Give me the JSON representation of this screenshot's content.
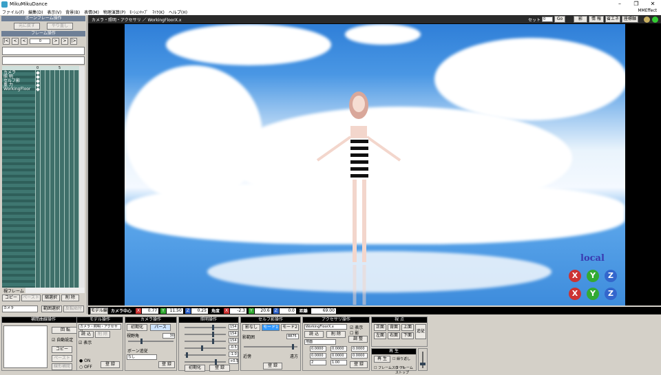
{
  "window": {
    "title": "MikuMikuDance",
    "mme_label": "MMEffect"
  },
  "menu": [
    "ファイル(F)",
    "編集(D)",
    "表示(V)",
    "背景(B)",
    "表情(M)",
    "物理演算(P)",
    "ﾓｰｼｮﾝｷｬﾌﾟ",
    "ﾏｲｸ(K)",
    "ヘルプ(H)"
  ],
  "left": {
    "bone_frame_header": "ボーンフレーム操作",
    "undo": "元に戻す",
    "redo": "やり直し",
    "frame_op_header": "フレーム操作",
    "frame_value": "0",
    "frame_nav": [
      "|<",
      "<",
      "<",
      ">",
      ">",
      "|>"
    ],
    "tl_ticks": [
      "0",
      "5"
    ],
    "tl_rows": [
      "カメラ",
      "照 明",
      "セルフ影",
      "重 力",
      "WorkingFloor"
    ],
    "view_frame_label": "視フレーム",
    "edit_buttons": [
      "コピー",
      "ペースト",
      "縮選択",
      "削 除"
    ],
    "camera_select": "カメラ",
    "range_select": "範囲選択",
    "reverse_paste": "反転貼付"
  },
  "viewport": {
    "toolbar_title": "カメラ・照明・アクセサリ ／ WorkingFloorX.x",
    "set_label": "セット",
    "set_value": "0",
    "go": "Go",
    "right_buttons": [
      "影",
      "情 報",
      "省エネ",
      "座標軸"
    ],
    "local_label": "local"
  },
  "camera_row": {
    "mode_label": "モデル編",
    "center_label": "カメラ中心",
    "x": "0.77",
    "y": "11.50",
    "z": "0.25",
    "angle_label": "角度",
    "ax": "-2.3",
    "ay": "20.6",
    "az": "0.0",
    "dist_label": "距離",
    "dist": "69.00"
  },
  "bottom": {
    "interp": {
      "header": "補間曲線操作",
      "rotate": "回 転",
      "auto": "自動設定",
      "copy": "コピー",
      "paste": "ペースト",
      "linear": "線形補間"
    },
    "model": {
      "header": "モデル操作",
      "select": "カメラ・照明・アクセサリ",
      "load": "読 込",
      "delete": "削 除",
      "display": "表示",
      "on": "ON",
      "off": "OFF",
      "register": "登 録"
    },
    "camera": {
      "header": "カメラ操作",
      "init": "初期化",
      "perspective": "パース",
      "fov_label": "視野角",
      "fov": "30",
      "bone_follow": "ボーン追従",
      "bone_none": "なし",
      "register": "登 録"
    },
    "light": {
      "header": "照明操作",
      "r": "154",
      "g": "154",
      "b": "154",
      "x": "-0.5",
      "y": "-1.0",
      "z": "+0.5",
      "init": "初期化",
      "register": "登 録"
    },
    "self_shadow": {
      "header": "セルフ影操作",
      "none": "影なし",
      "mode1": "モード1",
      "mode2": "モード2",
      "range_label": "影範囲",
      "range": "8875",
      "far": "遠方",
      "near": "近傍",
      "register": "登 録"
    },
    "accessory": {
      "header": "アクセサリ操作",
      "select": "WorkingFloorX.x",
      "show": "表示",
      "shadow": "影",
      "load": "読 込",
      "delete": "削 除",
      "adjust": "調 整",
      "parent": "地面",
      "x": "0.0000",
      "y": "0.0000",
      "z": "0.0000",
      "rx": "0.0000",
      "ry": "0.0000",
      "rz": "0.0000",
      "si": "2",
      "tr": "1.00",
      "register": "登 録"
    },
    "view": {
      "header": "視 点",
      "front": "正面",
      "back": "背面",
      "top": "上面",
      "left": "左面",
      "right": "右面",
      "bottom": "下面",
      "track": "追従"
    },
    "play": {
      "header": "再 生",
      "play": "再 生",
      "repeat": "繰り返し",
      "frame_start": "フレームスタート",
      "frame_stop": "フレームストップ"
    }
  }
}
